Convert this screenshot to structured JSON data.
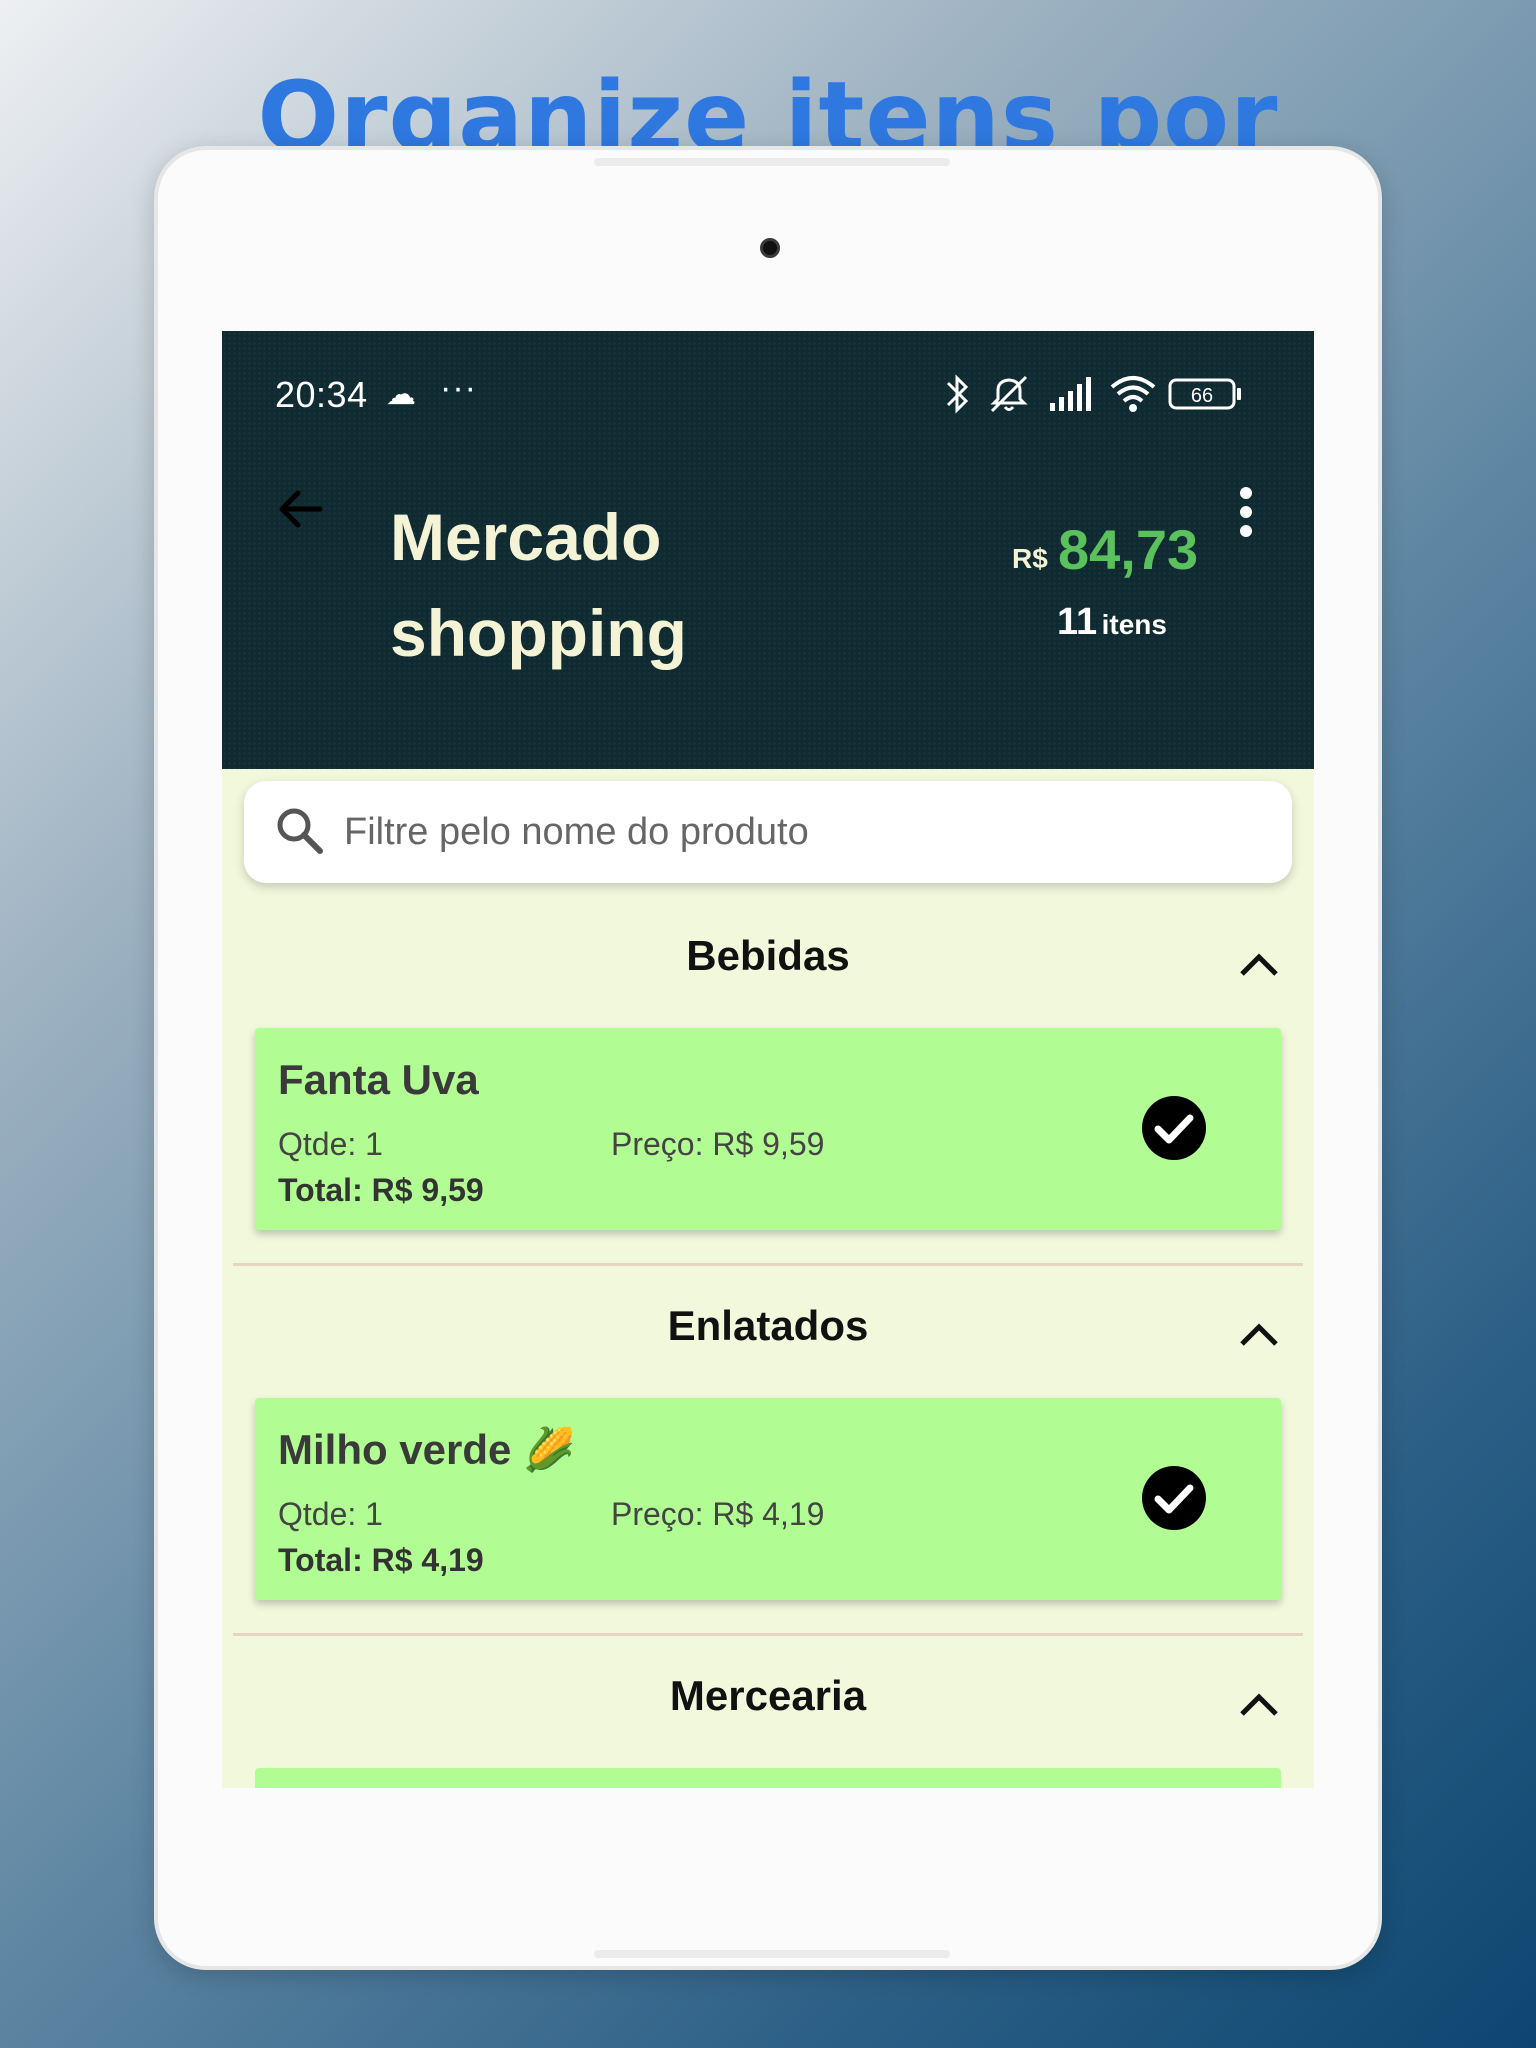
{
  "promo": {
    "headline": "Organize itens por"
  },
  "status_bar": {
    "time": "20:34",
    "dots": "···",
    "battery_level": "66"
  },
  "header": {
    "title": "Mercado shopping",
    "currency": "R$",
    "total": "84,73",
    "items_count": "11",
    "items_label": "itens"
  },
  "search": {
    "placeholder": "Filtre pelo nome do produto"
  },
  "categories": [
    {
      "name": "Bebidas",
      "items": [
        {
          "name": "Fanta Uva",
          "qty": "Qtde: 1",
          "price": "Preço: R$ 9,59",
          "total": "Total: R$ 9,59",
          "checked": true
        }
      ]
    },
    {
      "name": "Enlatados",
      "items": [
        {
          "name": "Milho verde 🌽",
          "qty": "Qtde: 1",
          "price": "Preço: R$ 4,19",
          "total": "Total: R$ 4,19",
          "checked": true
        }
      ]
    },
    {
      "name": "Mercearia",
      "items": []
    }
  ],
  "colors": {
    "appbar_background": "#0f2a30",
    "total_value": "#5bc15c",
    "list_background": "#f1f8dc",
    "card_background": "#b2fd93",
    "promo_headline": "#2f78e0"
  },
  "icons": {
    "status": [
      "cloud-icon",
      "bluetooth-icon",
      "mute-icon",
      "signal-icon",
      "wifi-icon",
      "battery-icon"
    ],
    "appbar": [
      "back-arrow-icon",
      "more-vert-icon"
    ],
    "list": [
      "search-icon",
      "chevron-up-icon",
      "check-circle-icon"
    ]
  }
}
